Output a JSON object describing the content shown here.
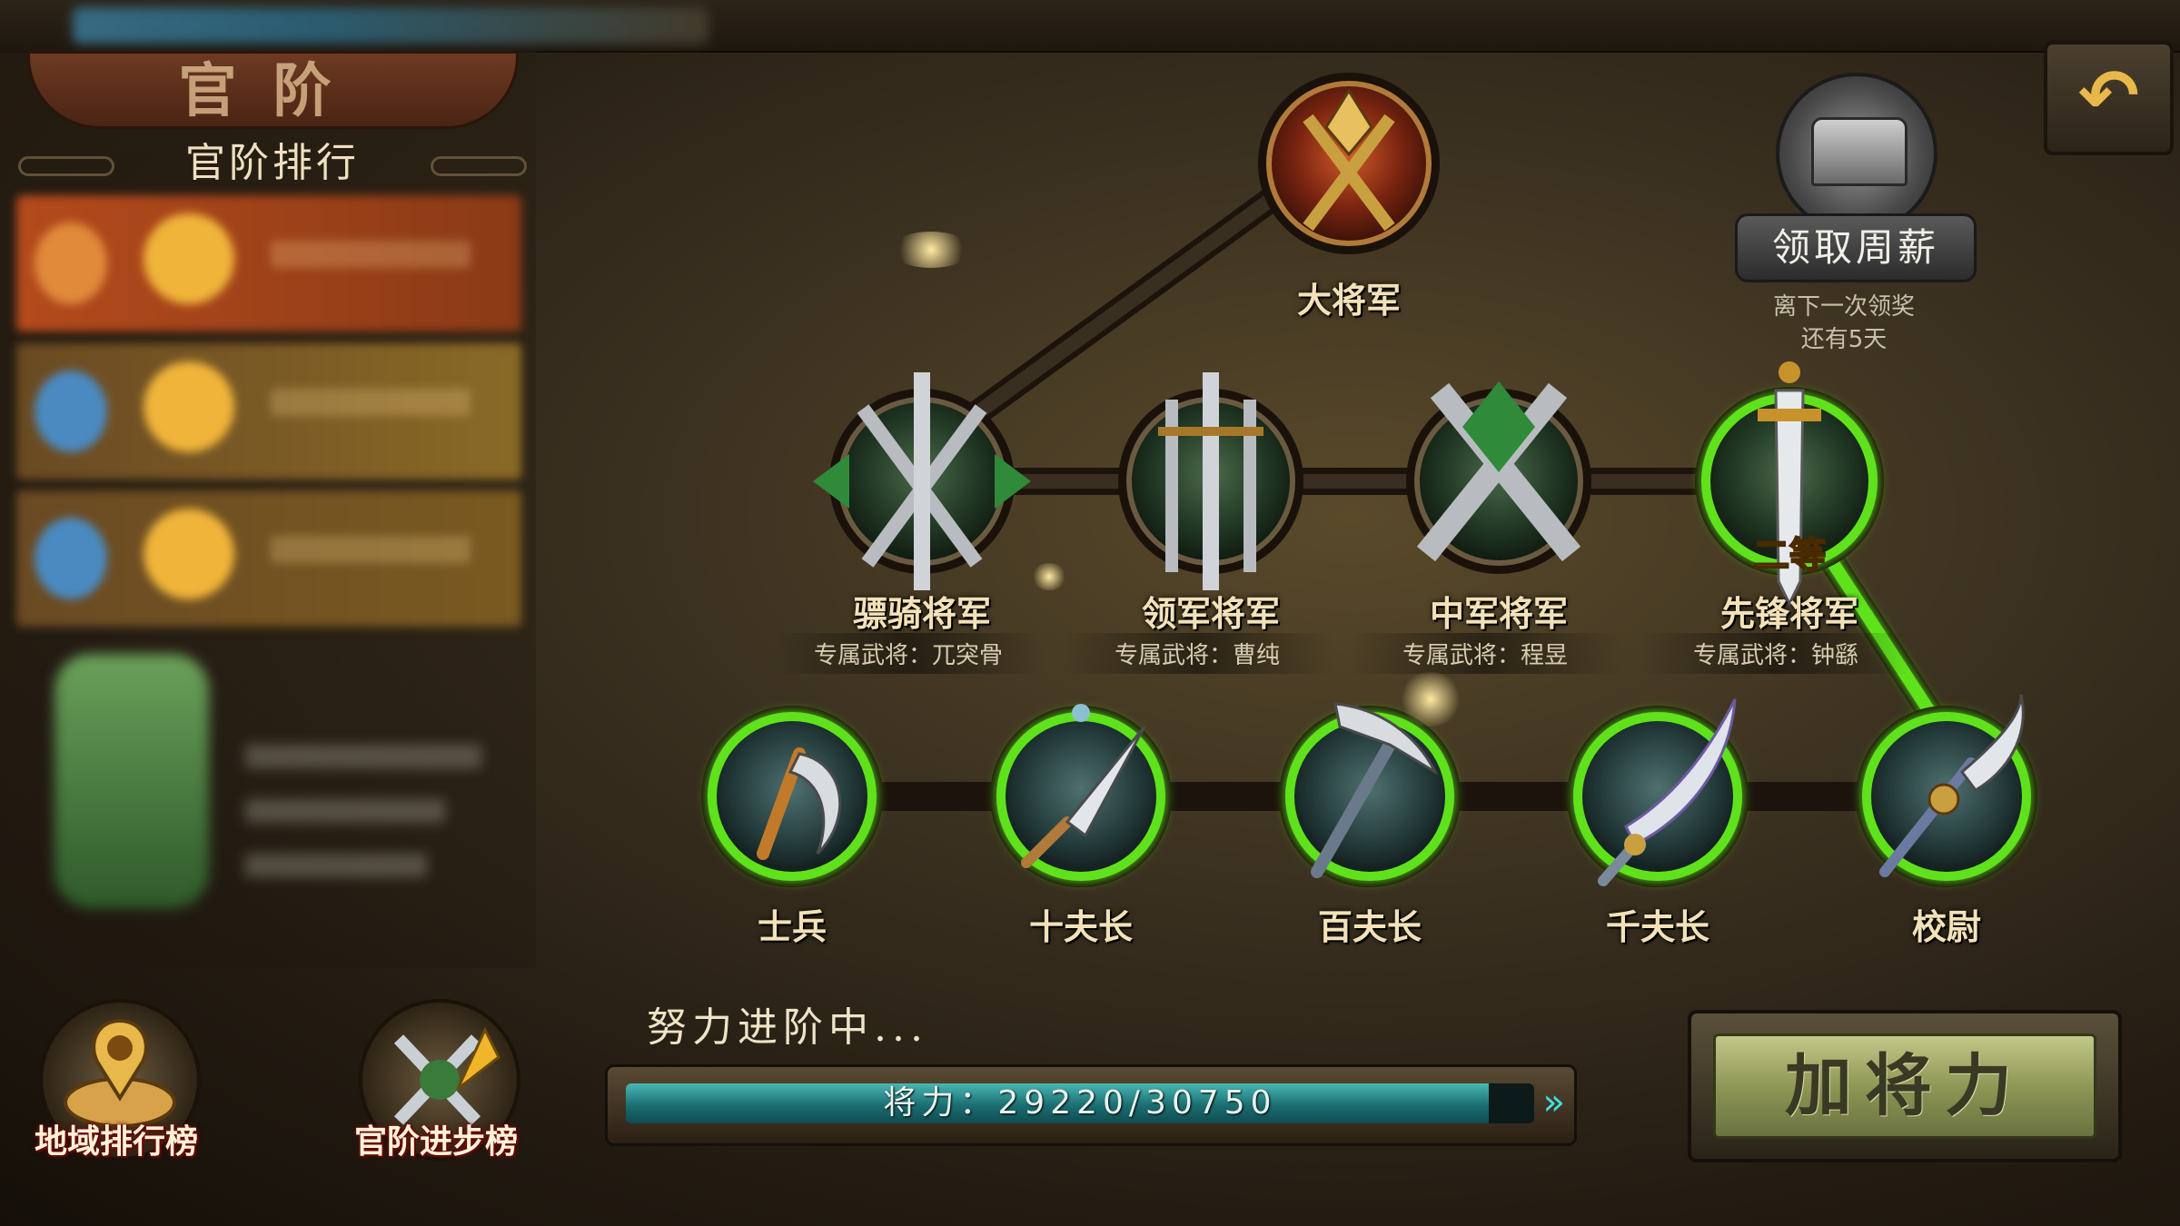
{
  "header": {
    "title": "官阶"
  },
  "ranking": {
    "title": "官阶排行"
  },
  "bottom_buttons": [
    {
      "label": "地域排行榜",
      "icon": "map-pin-icon"
    },
    {
      "label": "官阶进步榜",
      "icon": "swords-up-arrow-icon"
    }
  ],
  "ranks": {
    "top": {
      "name": "大将军",
      "icon": "axe-emblem-icon"
    },
    "generals": [
      {
        "name": "骠骑将军",
        "exclusive": "专属武将：兀突骨",
        "icon": "crossed-swords-emblem-icon",
        "unlocked": false
      },
      {
        "name": "领军将军",
        "exclusive": "专属武将：曹纯",
        "icon": "triple-swords-emblem-icon",
        "unlocked": false
      },
      {
        "name": "中军将军",
        "exclusive": "专属武将：程昱",
        "icon": "crossed-blades-emblem-icon",
        "unlocked": false
      },
      {
        "name": "先锋将军",
        "exclusive": "专属武将：钟繇",
        "icon": "single-sword-emblem-icon",
        "unlocked": true,
        "grade": "二等"
      }
    ],
    "officers": [
      {
        "name": "士兵",
        "icon": "sickle-icon",
        "unlocked": true
      },
      {
        "name": "十夫长",
        "icon": "dagger-icon",
        "unlocked": true
      },
      {
        "name": "百夫长",
        "icon": "pickaxe-icon",
        "unlocked": true
      },
      {
        "name": "千夫长",
        "icon": "saber-icon",
        "unlocked": true
      },
      {
        "name": "校尉",
        "icon": "glaive-icon",
        "unlocked": true
      }
    ]
  },
  "weekly_salary": {
    "label": "领取周薪",
    "note_line1": "离下一次领奖",
    "note_line2": "还有5天",
    "icon": "treasure-chest-icon"
  },
  "back_button": {
    "icon": "back-arrow-icon",
    "glyph": "↶"
  },
  "progress": {
    "status": "努力进阶中...",
    "label": "将力：29220/30750",
    "current": 29220,
    "max": 30750,
    "arrows": "»"
  },
  "add_power_button": {
    "label": "加将力"
  },
  "colors": {
    "accent_green": "#5fe21c",
    "gold": "#e8b94a",
    "bar_teal": "#1b6e72"
  }
}
